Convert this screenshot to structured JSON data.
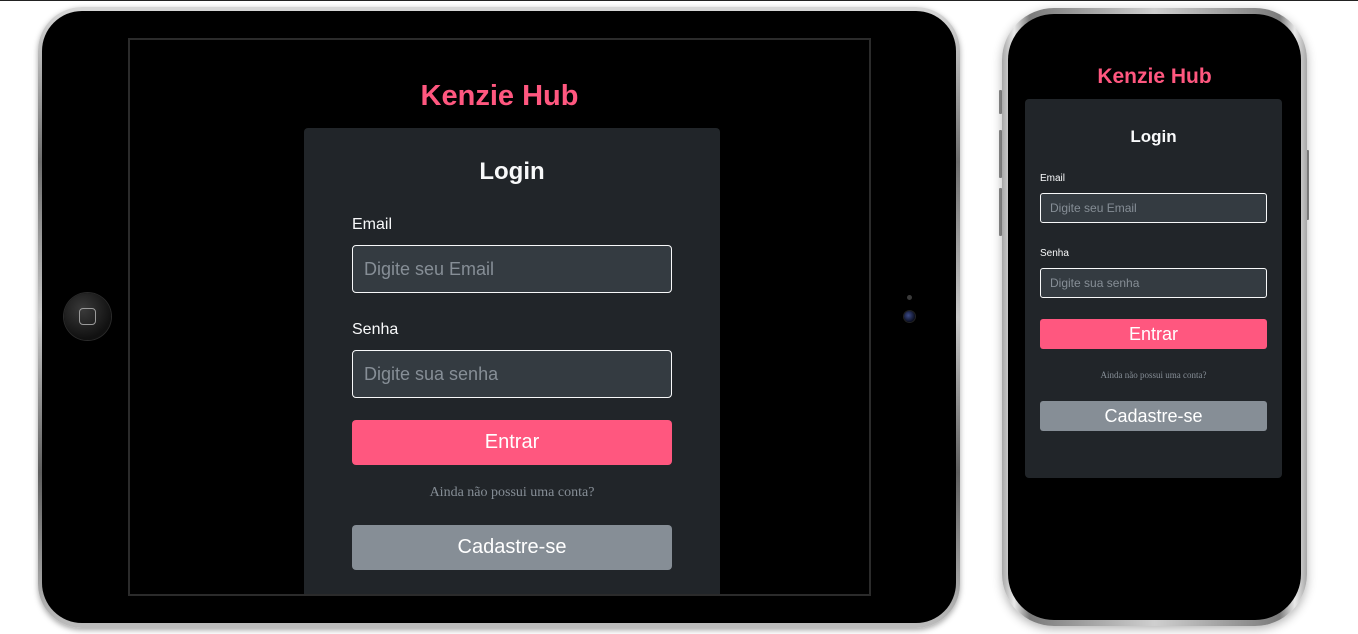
{
  "app": {
    "title": "Kenzie Hub"
  },
  "login": {
    "heading": "Login",
    "email_label": "Email",
    "email_placeholder": "Digite seu Email",
    "password_label": "Senha",
    "password_placeholder": "Digite sua senha",
    "submit_label": "Entrar",
    "signup_prompt": "Ainda não possui uma conta?",
    "signup_label": "Cadastre-se"
  },
  "colors": {
    "brand": "#ff577f",
    "card_background": "#212529",
    "input_background": "#343b41",
    "secondary_button": "#868e96",
    "page_background": "#000000"
  },
  "icons": {
    "home_button": "home-button-icon",
    "camera": "camera-icon"
  }
}
